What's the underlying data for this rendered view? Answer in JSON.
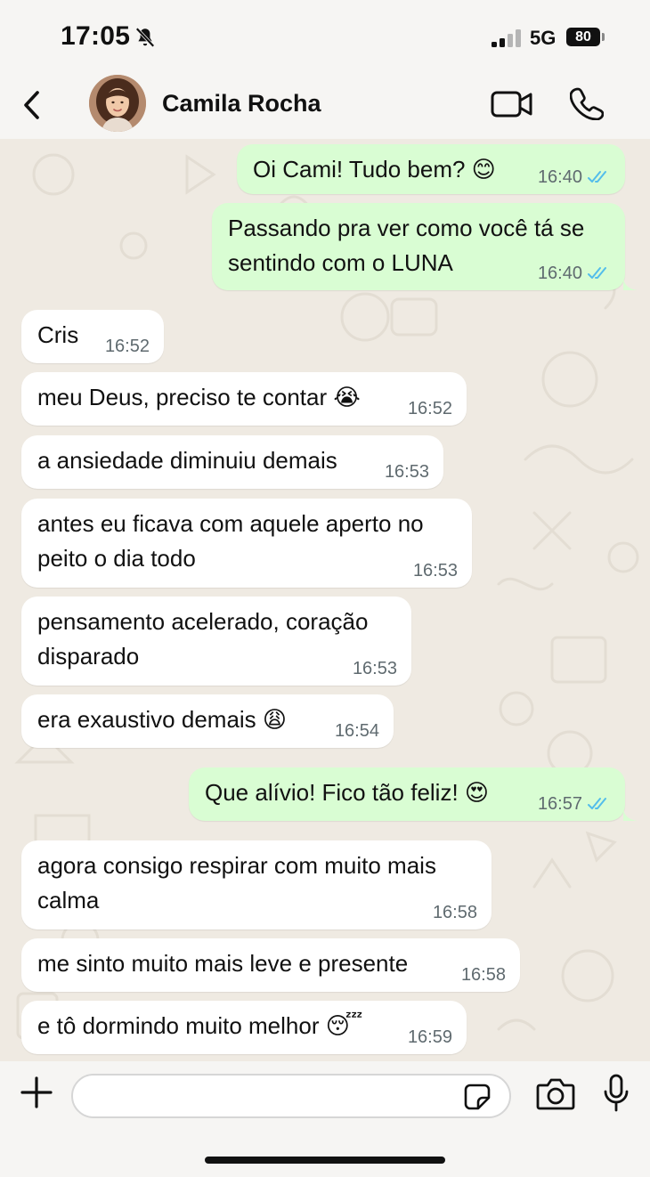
{
  "status_bar": {
    "time": "17:05",
    "network": "5G",
    "battery": "80"
  },
  "header": {
    "contact_name": "Camila Rocha"
  },
  "messages": [
    {
      "dir": "out",
      "text": "Oi Cami! Tudo bem? 😊",
      "time": "16:40",
      "read": true
    },
    {
      "dir": "out",
      "text": "Passando pra ver como você tá se sentindo com o LUNA",
      "time": "16:40",
      "read": true
    },
    {
      "dir": "in",
      "text": "Cris",
      "time": "16:52"
    },
    {
      "dir": "in",
      "text": "meu Deus, preciso te contar 😭",
      "time": "16:52"
    },
    {
      "dir": "in",
      "text": "a ansiedade diminuiu demais",
      "time": "16:53"
    },
    {
      "dir": "in",
      "text": "antes eu ficava com aquele aperto no peito o dia todo",
      "time": "16:53"
    },
    {
      "dir": "in",
      "text": "pensamento acelerado, coração disparado",
      "time": "16:53"
    },
    {
      "dir": "in",
      "text": "era exaustivo demais 😩",
      "time": "16:54"
    },
    {
      "dir": "out",
      "text": "Que alívio! Fico tão feliz! 😍",
      "time": "16:57",
      "read": true
    },
    {
      "dir": "in",
      "text": "agora consigo respirar com muito mais calma",
      "time": "16:58"
    },
    {
      "dir": "in",
      "text": "me sinto muito mais leve e presente",
      "time": "16:58"
    },
    {
      "dir": "in",
      "text": "e tô dormindo muito melhor 😴",
      "time": "16:59"
    }
  ],
  "composer": {
    "placeholder": ""
  },
  "colors": {
    "outgoing_bubble": "#d9fdd3",
    "incoming_bubble": "#ffffff",
    "read_ticks": "#53bdeb",
    "chat_bg": "#efeae2"
  }
}
